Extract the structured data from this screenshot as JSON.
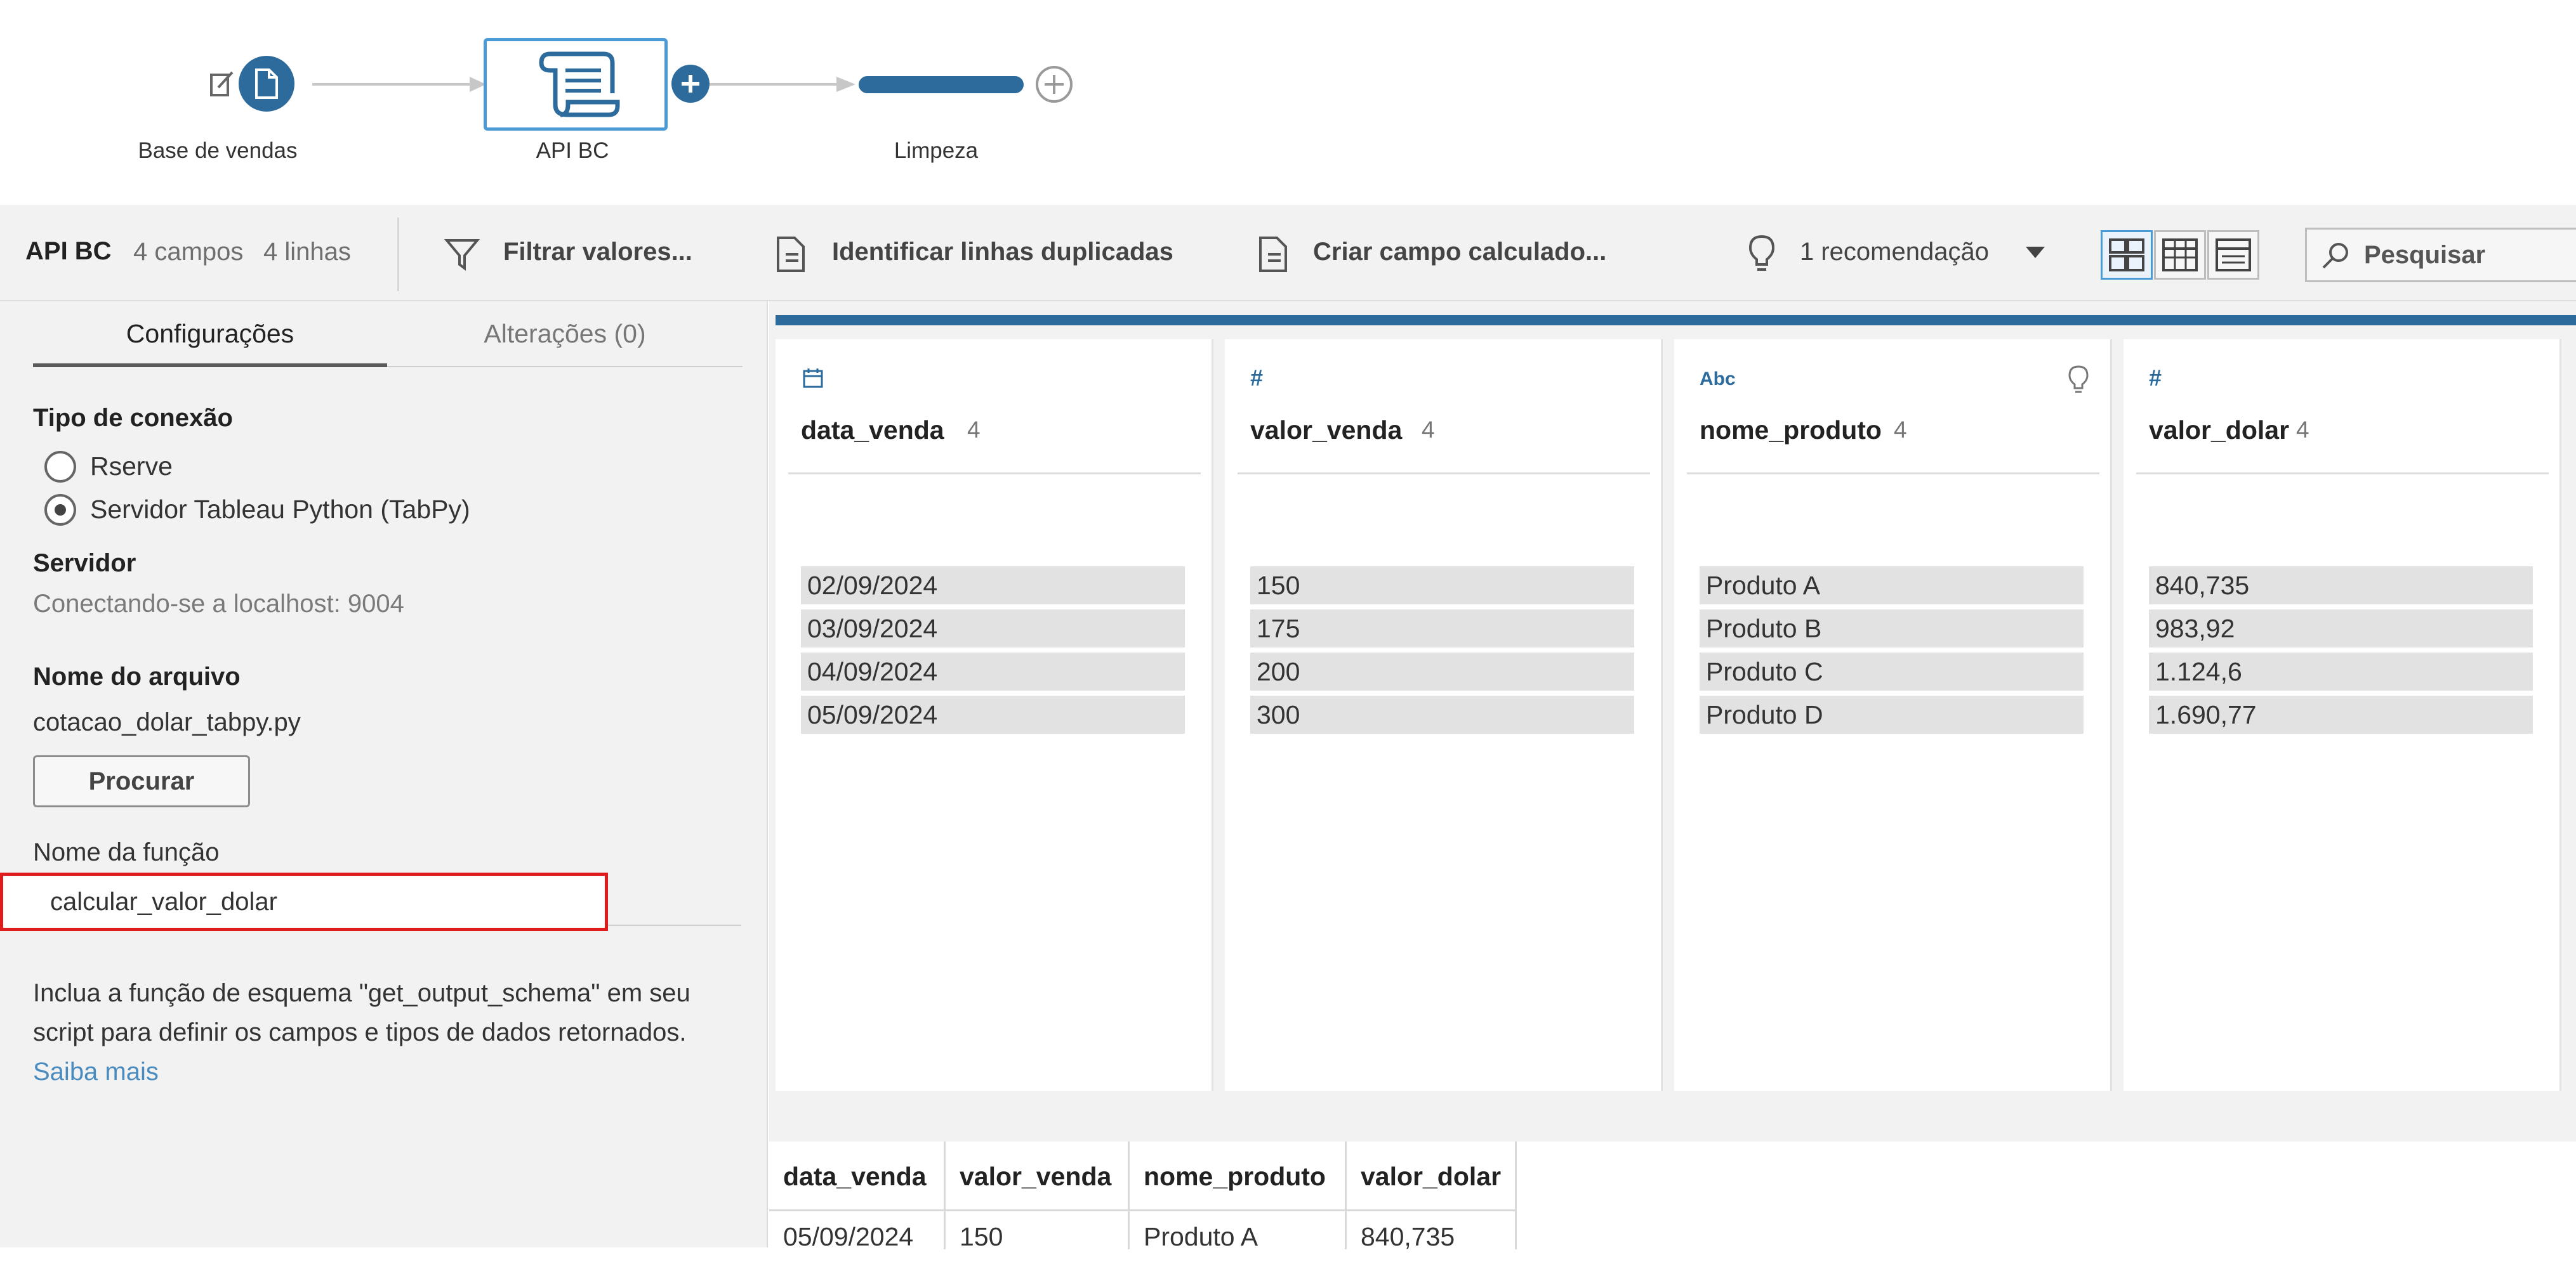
{
  "flow": {
    "nodes": [
      {
        "label": "Base de vendas"
      },
      {
        "label": "API BC"
      },
      {
        "label": "Limpeza"
      }
    ]
  },
  "toolbar": {
    "step_name": "API BC",
    "fields": "4 campos",
    "rows": "4 linhas",
    "filter_label": "Filtrar valores...",
    "duplicates_label": "Identificar linhas duplicadas",
    "calc_label": "Criar campo calculado...",
    "recommendation_label": "1 recomendação",
    "search_placeholder": "Pesquisar"
  },
  "settings": {
    "tabs": [
      "Configurações",
      "Alterações (0)"
    ],
    "connection_type_heading": "Tipo de conexão",
    "options": [
      "Rserve",
      "Servidor Tableau Python (TabPy)"
    ],
    "selected_option": "Servidor Tableau Python (TabPy)",
    "server_heading": "Servidor",
    "server_status": "Conectando-se a localhost: 9004",
    "file_heading": "Nome do arquivo",
    "file_name": "cotacao_dolar_tabpy.py",
    "browse_label": "Procurar",
    "function_label": "Nome da função",
    "function_value": "calcular_valor_dolar",
    "help_text": "Inclua a função de esquema \"get_output_schema\" em seu script para definir os campos e tipos de dados retornados.",
    "help_link": "Saiba mais"
  },
  "profile": {
    "cards": [
      {
        "type": "date",
        "type_icon": "calendar-icon",
        "name": "data_venda",
        "count": "4",
        "values": [
          "02/09/2024",
          "03/09/2024",
          "04/09/2024",
          "05/09/2024"
        ]
      },
      {
        "type": "number",
        "type_icon": "#",
        "name": "valor_venda",
        "count": "4",
        "values": [
          "150",
          "175",
          "200",
          "300"
        ]
      },
      {
        "type": "string",
        "type_icon": "Abc",
        "name": "nome_produto",
        "count": "4",
        "values": [
          "Produto A",
          "Produto B",
          "Produto C",
          "Produto D"
        ]
      },
      {
        "type": "number",
        "type_icon": "#",
        "name": "valor_dolar",
        "count": "4",
        "values": [
          "840,735",
          "983,92",
          "1.124,6",
          "1.690,77"
        ]
      }
    ]
  },
  "grid": {
    "headers": [
      "data_venda",
      "valor_venda",
      "nome_produto",
      "valor_dolar"
    ],
    "rows": [
      [
        "05/09/2024",
        "150",
        "Produto A",
        "840,735"
      ]
    ]
  },
  "colors": {
    "accent": "#2c6b9c",
    "selection": "#4a9ad6",
    "highlight_box": "#e01b1b",
    "link": "#4a8bbf"
  }
}
